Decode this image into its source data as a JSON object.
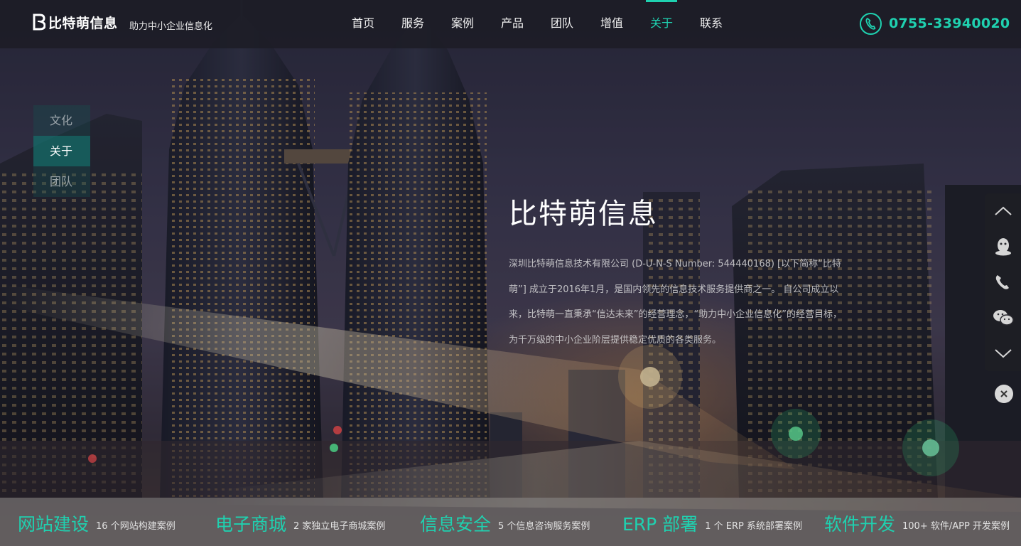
{
  "brand": {
    "name": "比特萌信息",
    "slogan": "助力中小企业信息化",
    "accent_color": "#1fd1b0"
  },
  "nav": {
    "items": [
      {
        "label": "首页"
      },
      {
        "label": "服务"
      },
      {
        "label": "案例"
      },
      {
        "label": "产品"
      },
      {
        "label": "团队"
      },
      {
        "label": "增值"
      },
      {
        "label": "关于"
      },
      {
        "label": "联系"
      }
    ],
    "active": "关于"
  },
  "phone": {
    "icon": "phone-icon",
    "number": "0755-33940020"
  },
  "subnav": {
    "items": [
      {
        "label": "文化"
      },
      {
        "label": "关于"
      },
      {
        "label": "团队"
      }
    ],
    "active": "关于"
  },
  "hero": {
    "title": "比特萌信息",
    "description": "深圳比特萌信息技术有限公司 (D-U-N-S Number: 544440168) [以下简称“比特萌”] 成立于2016年1月，是国内领先的信息技术服务提供商之一。 自公司成立以来，比特萌一直秉承“信达未来”的经营理念，“助力中小企业信息化”的经营目标， 为千万级的中小企业阶层提供稳定优质的各类服务。"
  },
  "float_bar": {
    "buttons": [
      {
        "icon": "chevron-up-icon"
      },
      {
        "icon": "qq-icon"
      },
      {
        "icon": "phone-icon"
      },
      {
        "icon": "wechat-icon"
      },
      {
        "icon": "chevron-down-icon"
      }
    ],
    "close_icon": "close-icon"
  },
  "stats": [
    {
      "title": "网站建设",
      "sub": "16 个网站构建案例"
    },
    {
      "title": "电子商城",
      "sub": "2 家独立电子商城案例"
    },
    {
      "title": "信息安全",
      "sub": "5 个信息咨询服务案例"
    },
    {
      "title": "ERP 部署",
      "sub": "1 个 ERP 系统部署案例"
    },
    {
      "title": "软件开发",
      "sub": "100+ 软件/APP 开发案例"
    }
  ]
}
